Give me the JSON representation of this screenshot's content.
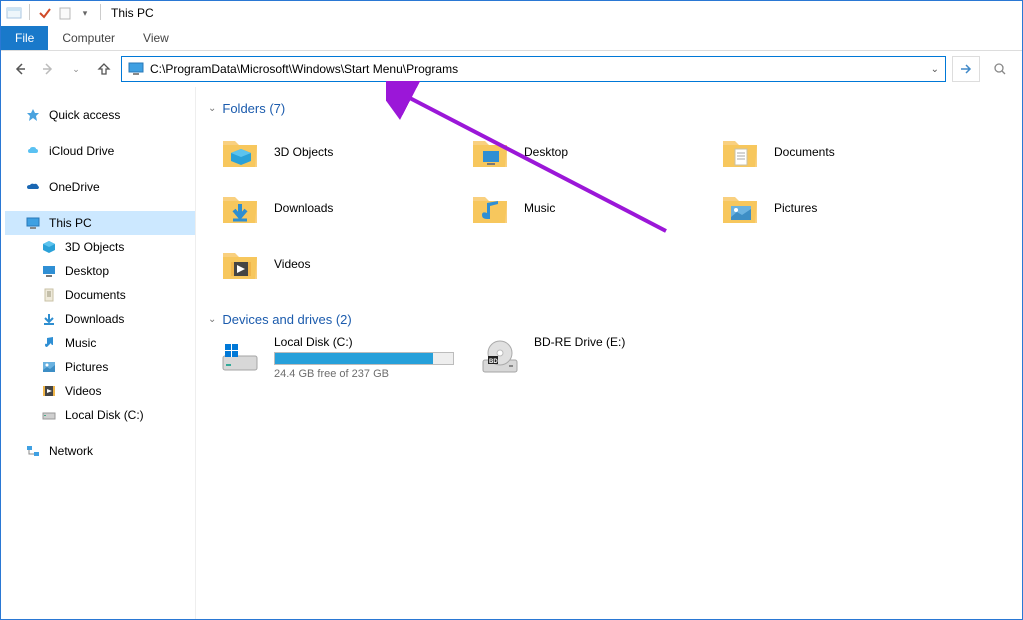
{
  "title": "This PC",
  "ribbon": {
    "file": "File",
    "computer": "Computer",
    "view": "View"
  },
  "address": {
    "path": "C:\\ProgramData\\Microsoft\\Windows\\Start Menu\\Programs"
  },
  "sidebar": {
    "quick_access": "Quick access",
    "icloud": "iCloud Drive",
    "onedrive": "OneDrive",
    "this_pc": "This PC",
    "children": [
      "3D Objects",
      "Desktop",
      "Documents",
      "Downloads",
      "Music",
      "Pictures",
      "Videos",
      "Local Disk (C:)"
    ],
    "network": "Network"
  },
  "sections": {
    "folders": {
      "title": "Folders (7)"
    },
    "drives": {
      "title": "Devices and drives (2)"
    }
  },
  "folders": [
    {
      "name": "3D Objects"
    },
    {
      "name": "Desktop"
    },
    {
      "name": "Documents"
    },
    {
      "name": "Downloads"
    },
    {
      "name": "Music"
    },
    {
      "name": "Pictures"
    },
    {
      "name": "Videos"
    }
  ],
  "drives": [
    {
      "name": "Local Disk (C:)",
      "free_text": "24.4 GB free of 237 GB",
      "fill_pct": 89
    },
    {
      "name": "BD-RE Drive (E:)",
      "free_text": "",
      "fill_pct": null
    }
  ]
}
